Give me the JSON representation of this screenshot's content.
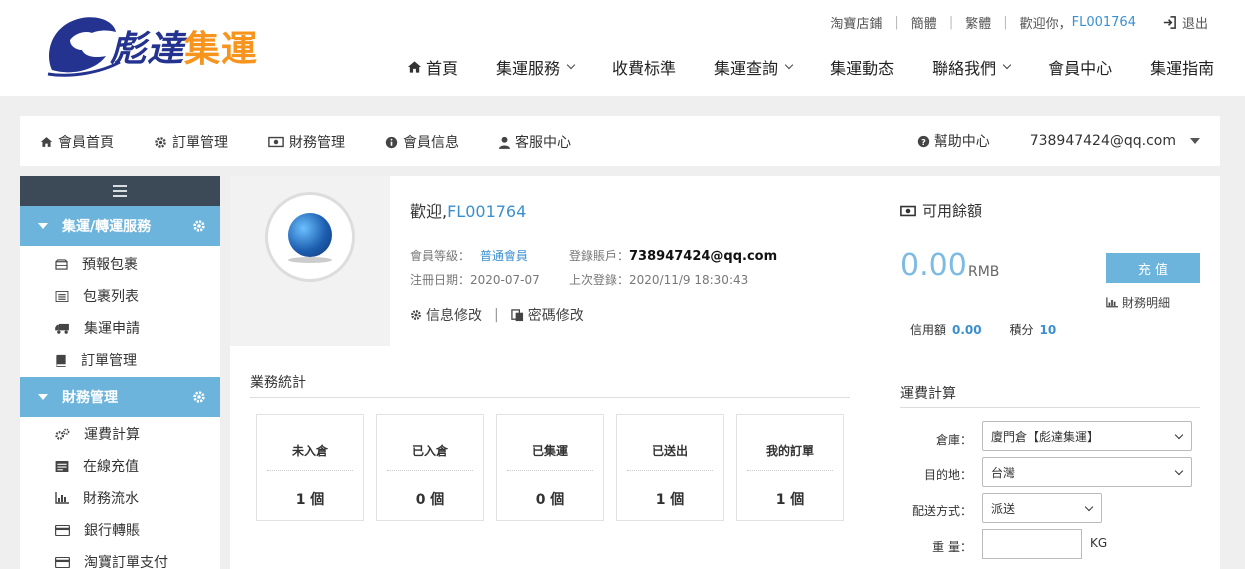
{
  "header": {
    "logo": {
      "prefix": "彪達",
      "suffix": "集運"
    },
    "toplinks": {
      "taobao": "淘寶店鋪",
      "simplified": "簡體",
      "traditional": "繁體",
      "welcome": "歡迎你，",
      "user_id": "FL001764",
      "logout": "退出"
    },
    "nav": [
      {
        "label": "首頁",
        "icon": "home-icon"
      },
      {
        "label": "集運服務",
        "dropdown": true
      },
      {
        "label": "收費标準"
      },
      {
        "label": "集運查詢",
        "dropdown": true
      },
      {
        "label": "集運動态"
      },
      {
        "label": "聯絡我們",
        "dropdown": true
      },
      {
        "label": "會員中心"
      },
      {
        "label": "集運指南"
      }
    ]
  },
  "subnav": {
    "items": [
      {
        "label": "會員首頁",
        "icon": "home-icon"
      },
      {
        "label": "訂單管理",
        "icon": "gear-icon"
      },
      {
        "label": "財務管理",
        "icon": "money-icon"
      },
      {
        "label": "會員信息",
        "icon": "info-icon"
      },
      {
        "label": "客服中心",
        "icon": "user-icon"
      }
    ],
    "help": "幫助中心",
    "account": "738947424@qq.com"
  },
  "sidebar": {
    "sections": [
      {
        "title": "集運/轉運服務",
        "items": [
          {
            "label": "預報包裹",
            "icon": "package-icon"
          },
          {
            "label": "包裹列表",
            "icon": "list-icon"
          },
          {
            "label": "集運申請",
            "icon": "truck-icon"
          },
          {
            "label": "訂單管理",
            "icon": "book-icon"
          }
        ]
      },
      {
        "title": "財務管理",
        "items": [
          {
            "label": "運費計算",
            "icon": "gears-icon"
          },
          {
            "label": "在線充值",
            "icon": "card-list-icon"
          },
          {
            "label": "財務流水",
            "icon": "bar-chart-icon"
          },
          {
            "label": "銀行轉賬",
            "icon": "credit-card-icon"
          },
          {
            "label": "淘寶訂單支付",
            "icon": "credit-card-icon"
          }
        ]
      }
    ]
  },
  "profile": {
    "welcome": "歡迎,",
    "user_id": "FL001764",
    "level_label": "會員等級：",
    "level": "普通會員",
    "account_label": "登錄賬戶：",
    "account": "738947424@qq.com",
    "reg_label": "注冊日期：",
    "reg_date": "2020-07-07",
    "last_label": "上次登錄：",
    "last_login": "2020/11/9 18:30:43",
    "edit_info": "信息修改",
    "edit_password": "密碼修改"
  },
  "stats": {
    "title": "業務統計",
    "boxes": [
      {
        "label": "未入倉",
        "value": "1 個"
      },
      {
        "label": "已入倉",
        "value": "0 個"
      },
      {
        "label": "已集運",
        "value": "0 個"
      },
      {
        "label": "已送出",
        "value": "1 個"
      },
      {
        "label": "我的訂單",
        "value": "1 個"
      }
    ]
  },
  "balance": {
    "title": "可用餘額",
    "amount": "0.00",
    "unit": "RMB",
    "recharge": "充 值",
    "finance_detail": "財務明細",
    "credit_label": "信用額",
    "credit_value": "0.00",
    "points_label": "積分",
    "points_value": "10"
  },
  "calculator": {
    "title": "運費計算",
    "warehouse_label": "倉庫：",
    "warehouse_value": "廈門倉【彪達集運】",
    "destination_label": "目的地：",
    "destination_value": "台灣",
    "shipping_label": "配送方式：",
    "shipping_value": "派送",
    "weight_label": "重 量：",
    "weight_unit": "KG"
  }
}
